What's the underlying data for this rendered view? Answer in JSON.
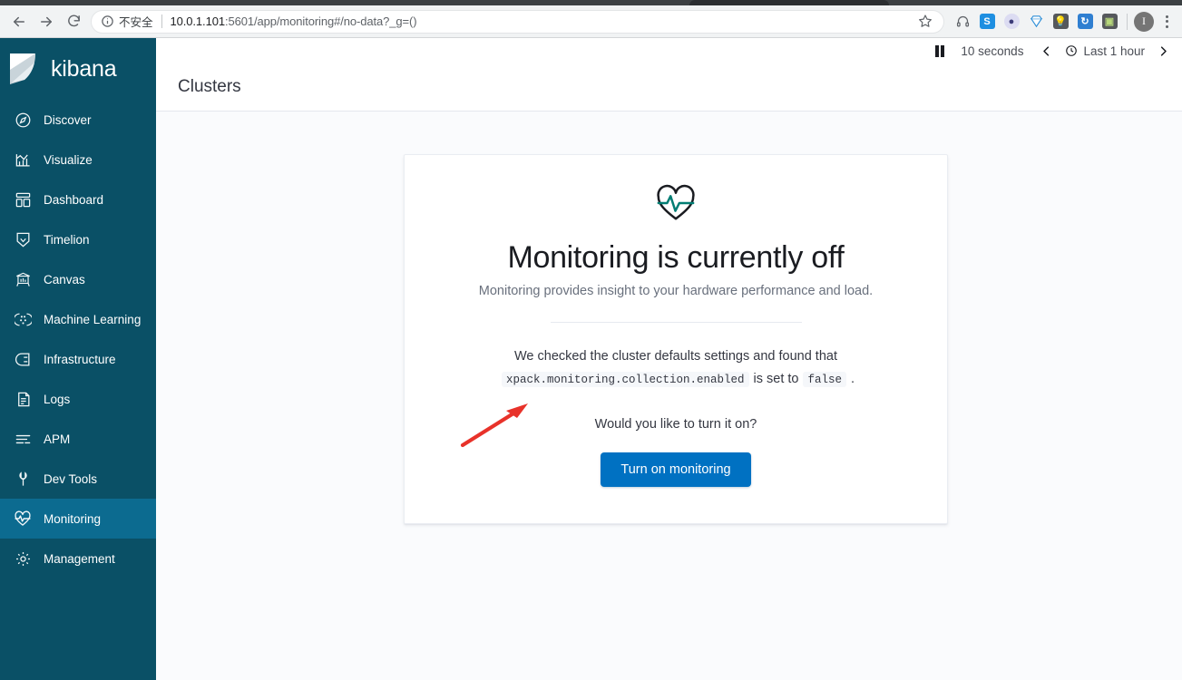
{
  "browser": {
    "back_icon": "back-arrow-icon",
    "forward_icon": "forward-arrow-icon",
    "reload_icon": "reload-icon",
    "security_label": "不安全",
    "url_host": "10.0.1.101",
    "url_rest": ":5601/app/monitoring#/no-data?_g=()",
    "url_full": "10.0.1.101:5601/app/monitoring#/no-data?_g=()",
    "bookmark_icon": "star-icon",
    "extensions": [
      {
        "name": "headphones-extension-icon",
        "glyph": "Ω",
        "bg": "transparent",
        "color": "#5f6368"
      },
      {
        "name": "evernote-extension-icon",
        "glyph": "S",
        "bg": "#1e8fe1",
        "color": "#ffffff"
      },
      {
        "name": "globe-extension-icon",
        "glyph": "●",
        "bg": "#d9d9f0",
        "color": "#3a3a7a"
      },
      {
        "name": "diamond-extension-icon",
        "glyph": "▼",
        "bg": "transparent",
        "color": "#3fa9f5"
      },
      {
        "name": "bulb-extension-icon",
        "glyph": "●",
        "bg": "#55585c",
        "color": "#ffffff"
      },
      {
        "name": "sync-extension-icon",
        "glyph": "↻",
        "bg": "#2f7fd1",
        "color": "#ffffff"
      },
      {
        "name": "screenshot-extension-icon",
        "glyph": "▣",
        "bg": "#55585c",
        "color": "#b6d77a"
      }
    ],
    "profile_initial": "I",
    "menu_icon": "kebab-menu-icon"
  },
  "sidebar": {
    "brand": "kibana",
    "logo_icon": "kibana-logo-icon",
    "items": [
      {
        "label": "Discover",
        "icon": "compass-icon",
        "active": false
      },
      {
        "label": "Visualize",
        "icon": "bar-chart-icon",
        "active": false
      },
      {
        "label": "Dashboard",
        "icon": "dashboard-grid-icon",
        "active": false
      },
      {
        "label": "Timelion",
        "icon": "timelion-shield-icon",
        "active": false
      },
      {
        "label": "Canvas",
        "icon": "canvas-easel-icon",
        "active": false
      },
      {
        "label": "Machine Learning",
        "icon": "machine-learning-icon",
        "active": false
      },
      {
        "label": "Infrastructure",
        "icon": "infrastructure-icon",
        "active": false
      },
      {
        "label": "Logs",
        "icon": "logs-document-icon",
        "active": false
      },
      {
        "label": "APM",
        "icon": "apm-lines-icon",
        "active": false
      },
      {
        "label": "Dev Tools",
        "icon": "wrench-icon",
        "active": false
      },
      {
        "label": "Monitoring",
        "icon": "heart-pulse-icon",
        "active": true
      },
      {
        "label": "Management",
        "icon": "gear-icon",
        "active": false
      }
    ]
  },
  "topbar": {
    "pause_icon": "pause-icon",
    "refresh_interval": "10 seconds",
    "prev_icon": "chevron-left-icon",
    "clock_icon": "clock-icon",
    "time_range": "Last 1 hour",
    "next_icon": "chevron-right-icon"
  },
  "page": {
    "title": "Clusters"
  },
  "card": {
    "icon": "heart-pulse-icon",
    "title": "Monitoring is currently off",
    "subtitle": "Monitoring provides insight to your hardware performance and load.",
    "explain_line1": "We checked the cluster defaults settings and found that",
    "setting_key": "xpack.monitoring.collection.enabled",
    "explain_mid": "is set to",
    "setting_value": "false",
    "explain_end": ".",
    "question": "Would you like to turn it on?",
    "cta_label": "Turn on monitoring"
  },
  "annotation": {
    "arrow": "red-arrow-annotation"
  },
  "colors": {
    "sidebar_bg": "#0a5066",
    "sidebar_active": "#0c6b90",
    "primary_button": "#0071c2",
    "page_bg": "#fafbfd",
    "heart_pulse_teal": "#017d73",
    "annotation_red": "#e8322a"
  }
}
